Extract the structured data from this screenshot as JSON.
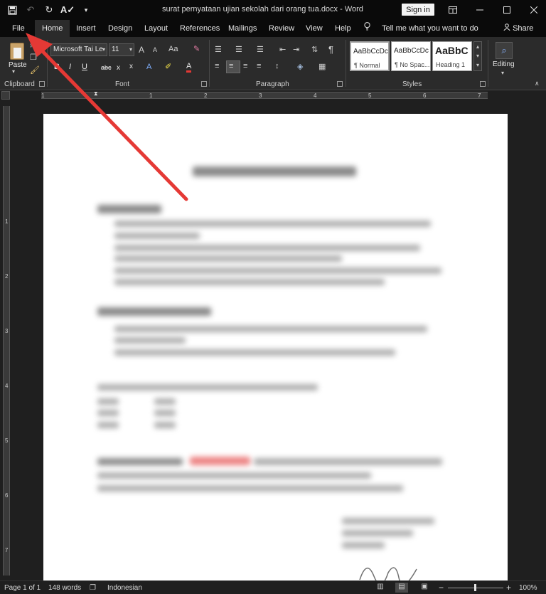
{
  "window": {
    "doc_title": "surat pernyataan ujian sekolah dari orang tua.docx  -  Word",
    "sign_in": "Sign in"
  },
  "tabs": [
    "File",
    "Home",
    "Insert",
    "Design",
    "Layout",
    "References",
    "Mailings",
    "Review",
    "View",
    "Help"
  ],
  "tell_me": "Tell me what you want to do",
  "share": "Share",
  "ribbon": {
    "clipboard": {
      "paste": "Paste",
      "label": "Clipboard"
    },
    "font": {
      "name": "Microsoft Tai Le",
      "size": "11",
      "label": "Font",
      "grow": "A",
      "shrink": "A",
      "change_case": "Aa",
      "bold": "B",
      "italic": "I",
      "underline": "U",
      "strike": "abc",
      "subscript": "x",
      "superscript": "x",
      "font_color": "A",
      "text_effects": "A"
    },
    "paragraph": {
      "label": "Paragraph",
      "pilcrow": "¶"
    },
    "styles": {
      "label": "Styles",
      "items": [
        {
          "sample": "AaBbCcDc",
          "name": "¶ Normal"
        },
        {
          "sample": "AaBbCcDc",
          "name": "¶ No Spac..."
        },
        {
          "sample": "AaBbC",
          "name": "Heading 1"
        }
      ]
    },
    "editing": {
      "label": "Editing"
    }
  },
  "ruler": {
    "h_numbers": [
      "1",
      "1",
      "2",
      "3",
      "4",
      "5",
      "6",
      "7"
    ],
    "v_numbers": [
      "1",
      "2",
      "3",
      "4",
      "5",
      "6",
      "7"
    ]
  },
  "status": {
    "page": "Page 1 of 1",
    "words": "148 words",
    "language": "Indonesian",
    "zoom": "100%",
    "zoom_minus": "−",
    "zoom_plus": "+"
  },
  "colors": {
    "titlebar": "#0a0a0a",
    "ribbon": "#2b2b2b",
    "canvas": "#1f1f1f",
    "arrow": "#e53935"
  },
  "icons": {
    "save": "save-icon",
    "undo": "undo-icon",
    "redo": "redo-icon",
    "spelling": "spelling-icon",
    "customize": "customize-qat-icon",
    "ribbon_display": "ribbon-display-icon",
    "minimize": "minimize-icon",
    "maximize": "maximize-icon",
    "close": "close-icon",
    "lightbulb": "lightbulb-icon",
    "share": "share-person-icon",
    "arrow": "red-arrow-annotation"
  }
}
